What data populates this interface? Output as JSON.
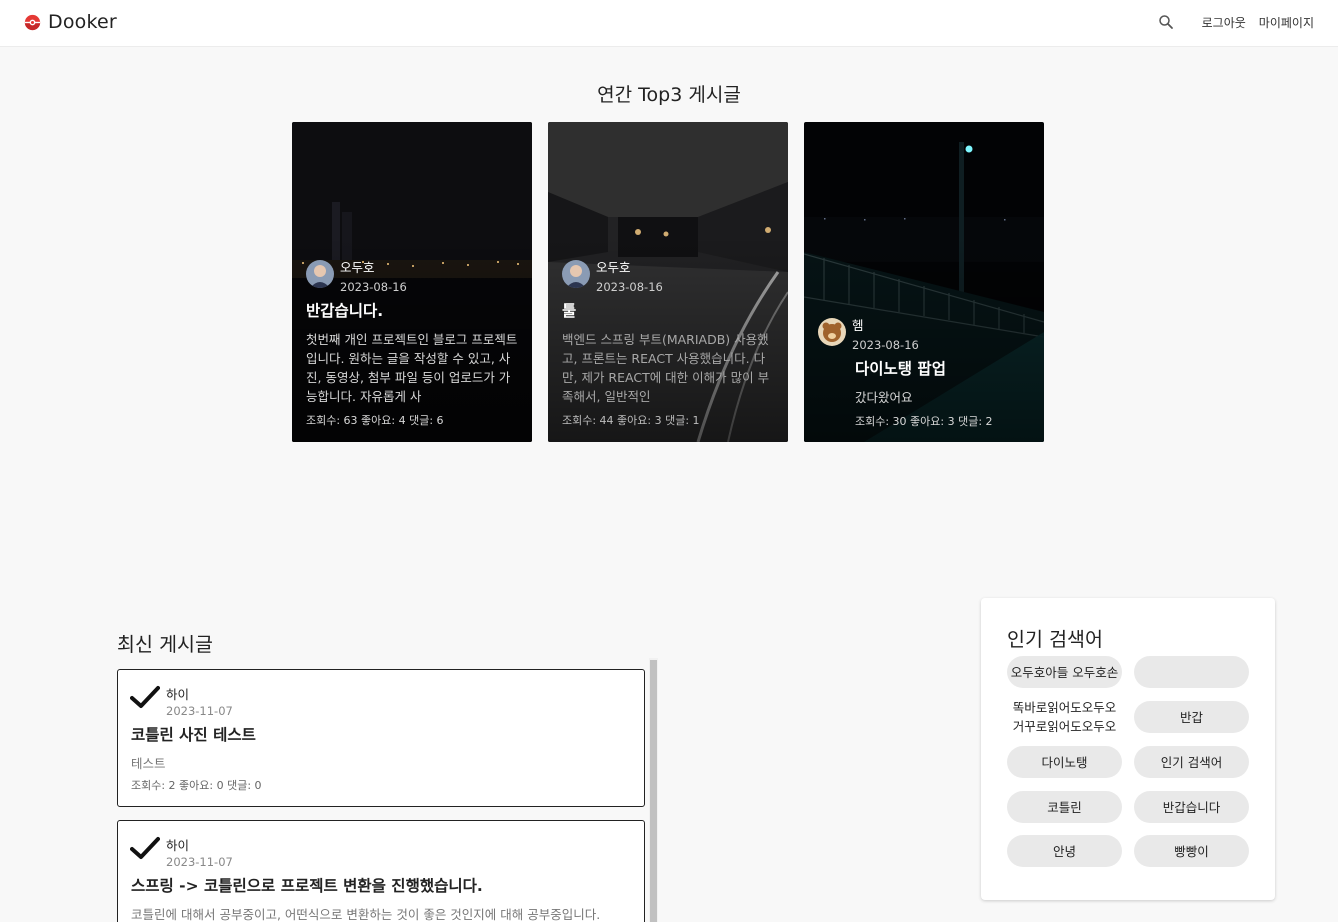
{
  "header": {
    "brand": "Dooker",
    "logout_label": "로그아웃",
    "mypage_label": "마이페이지"
  },
  "top3": {
    "title": "연간 Top3 게시글",
    "cards": [
      {
        "author": "오두호",
        "date": "2023-08-16",
        "title": "반갑습니다.",
        "desc": "첫번째 개인 프로젝트인 블로그 프로젝트입니다. 원하는 글을 작성할 수 있고, 사진, 동영상, 첨부 파일 등이 업로드가 가능합니다. 자유롭게 사",
        "stats": "조회수: 63 좋아요: 4 댓글: 6"
      },
      {
        "author": "오두호",
        "date": "2023-08-16",
        "title": "툴",
        "desc": "백엔드 스프링 부트(MARIADB) 사용했고, 프론트는 REACT 사용했습니다. 다만, 제가 REACT에 대한 이해가 많이 부족해서, 일반적인",
        "stats": "조회수: 44 좋아요: 3 댓글: 1"
      },
      {
        "author": "헴",
        "date": "2023-08-16",
        "title": "다이노탱 팝업",
        "desc": "갔다왔어요",
        "stats": "조회수: 30 좋아요: 3 댓글: 2"
      }
    ]
  },
  "latest": {
    "title": "최신 게시글",
    "posts": [
      {
        "author": "하이",
        "date": "2023-11-07",
        "title": "코틀린 사진 테스트",
        "desc": "테스트",
        "stats": "조회수: 2 좋아요: 0 댓글: 0"
      },
      {
        "author": "하이",
        "date": "2023-11-07",
        "title": "스프링 -> 코틀린으로 프로젝트 변환을 진행했습니다.",
        "desc": "코틀린에 대해서 공부중이고, 어떤식으로 변환하는 것이 좋은 것인지에 대해 공부중입니다.",
        "stats": ""
      }
    ]
  },
  "popular": {
    "title": "인기 검색어",
    "keywords": [
      "오두호아들 오두호손",
      "",
      "똑바로읽어도오두오 거꾸로읽어도오두오",
      "반갑",
      "다이노탱",
      "인기 검색어",
      "코틀린",
      "반갑습니다",
      "안녕",
      "빵빵이"
    ]
  },
  "colors": {
    "logo_red": "#e53935",
    "chip_bg": "#e9e9e9",
    "header_bg": "#ffffff",
    "page_bg": "#f8f8f8"
  },
  "icons": {
    "brand": "pokeball-icon",
    "search": "search-icon",
    "post_mark": "check-icon"
  }
}
